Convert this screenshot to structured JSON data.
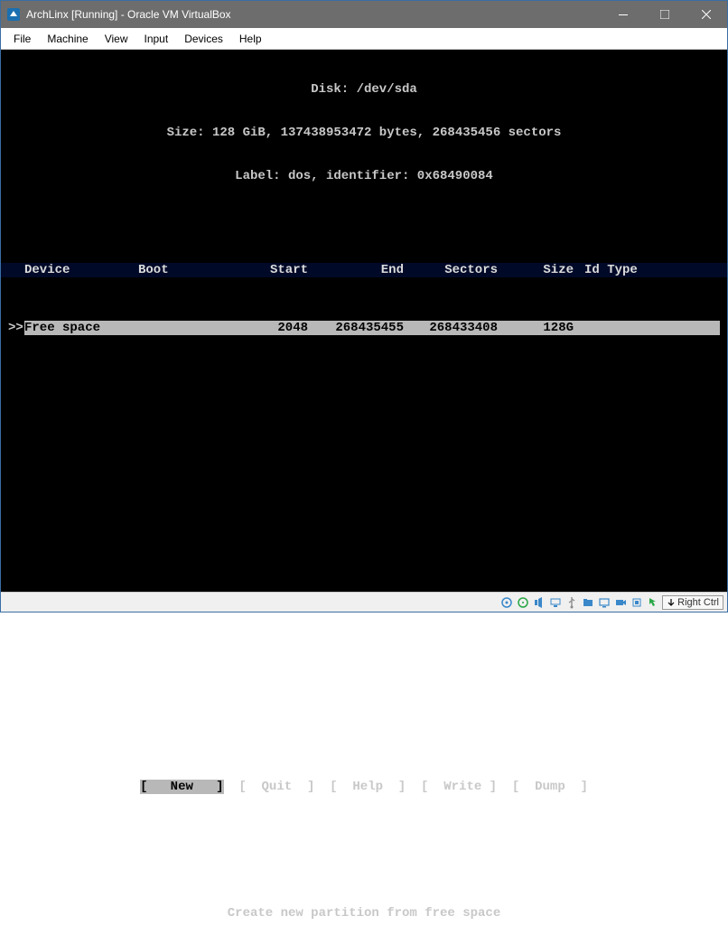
{
  "window": {
    "title": "ArchLinx [Running] - Oracle VM VirtualBox"
  },
  "menu": {
    "items": [
      "File",
      "Machine",
      "View",
      "Input",
      "Devices",
      "Help"
    ]
  },
  "disk": {
    "header_line": "Disk: /dev/sda",
    "size_line": "Size: 128 GiB, 137438953472 bytes, 268435456 sectors",
    "label_line": "Label: dos, identifier: 0x68490084"
  },
  "table": {
    "headers": {
      "device": "Device",
      "boot": "Boot",
      "start": "Start",
      "end": "End",
      "sectors": "Sectors",
      "size": "Size",
      "idtype": "Id Type"
    },
    "row": {
      "marker": ">>",
      "device": "Free space",
      "boot": "",
      "start": "2048",
      "end": "268435455",
      "sectors": "268433408",
      "size": "128G",
      "idtype": ""
    }
  },
  "buttons": {
    "new": "New",
    "quit": "Quit",
    "help": "Help",
    "write": "Write",
    "dump": "Dump"
  },
  "hint": "Create new partition from free space",
  "status": {
    "right_ctrl": "Right Ctrl"
  }
}
